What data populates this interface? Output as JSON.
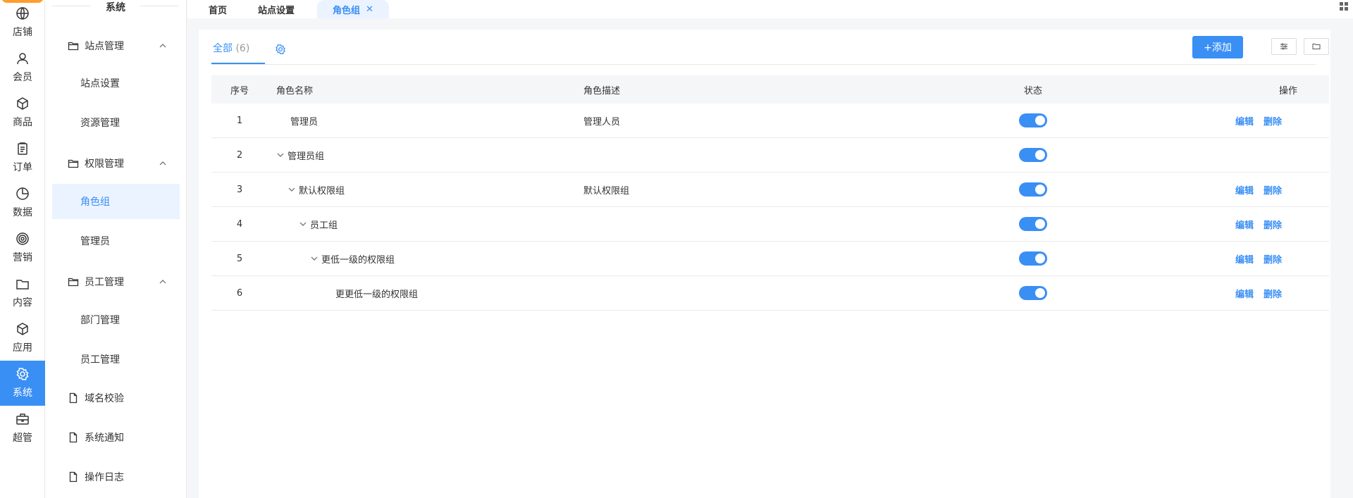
{
  "rail": {
    "items": [
      {
        "label": "店铺",
        "icon": "shop-icon"
      },
      {
        "label": "会员",
        "icon": "user-icon"
      },
      {
        "label": "商品",
        "icon": "box-icon"
      },
      {
        "label": "订单",
        "icon": "clipboard-icon"
      },
      {
        "label": "数据",
        "icon": "pie-chart-icon"
      },
      {
        "label": "营销",
        "icon": "target-icon"
      },
      {
        "label": "内容",
        "icon": "folder-icon"
      },
      {
        "label": "应用",
        "icon": "cube-icon"
      },
      {
        "label": "系统",
        "icon": "gear-icon"
      },
      {
        "label": "超管",
        "icon": "briefcase-icon"
      }
    ],
    "active": "系统"
  },
  "sidebar": {
    "title": "系统",
    "groups": {
      "site": {
        "label": "站点管理",
        "items": [
          "站点设置",
          "资源管理"
        ]
      },
      "perm": {
        "label": "权限管理",
        "items": [
          "角色组",
          "管理员"
        ]
      },
      "staff": {
        "label": "员工管理",
        "items": [
          "部门管理",
          "员工管理"
        ]
      },
      "domain": {
        "label": "域名校验"
      },
      "notice": {
        "label": "系统通知"
      },
      "log": {
        "label": "操作日志"
      }
    },
    "active_item": "角色组"
  },
  "tabs": [
    "首页",
    "站点设置",
    "角色组"
  ],
  "active_tab": "角色组",
  "filter": {
    "label": "全部",
    "count": "(6)"
  },
  "toolbar": {
    "add_label": "+添加"
  },
  "table": {
    "headers": [
      "序号",
      "角色名称",
      "角色描述",
      "状态",
      "操作"
    ],
    "rows": [
      {
        "idx": "1",
        "name": "管理员",
        "desc": "管理人员",
        "status": true,
        "ops": [
          "编辑",
          "删除"
        ]
      },
      {
        "idx": "2",
        "name": "管理员组",
        "desc": "",
        "status": true,
        "ops": []
      },
      {
        "idx": "3",
        "name": "默认权限组",
        "desc": "默认权限组",
        "status": true,
        "ops": [
          "编辑",
          "删除"
        ]
      },
      {
        "idx": "4",
        "name": "员工组",
        "desc": "",
        "status": true,
        "ops": [
          "编辑",
          "删除"
        ]
      },
      {
        "idx": "5",
        "name": "更低一级的权限组",
        "desc": "",
        "status": true,
        "ops": [
          "编辑",
          "删除"
        ]
      },
      {
        "idx": "6",
        "name": "更更低一级的权限组",
        "desc": "",
        "status": true,
        "ops": [
          "编辑",
          "删除"
        ]
      }
    ]
  },
  "colors": {
    "accent": "#3a8ff5",
    "active_bg": "#eaf3ff",
    "logo": "#ff9d2f"
  }
}
